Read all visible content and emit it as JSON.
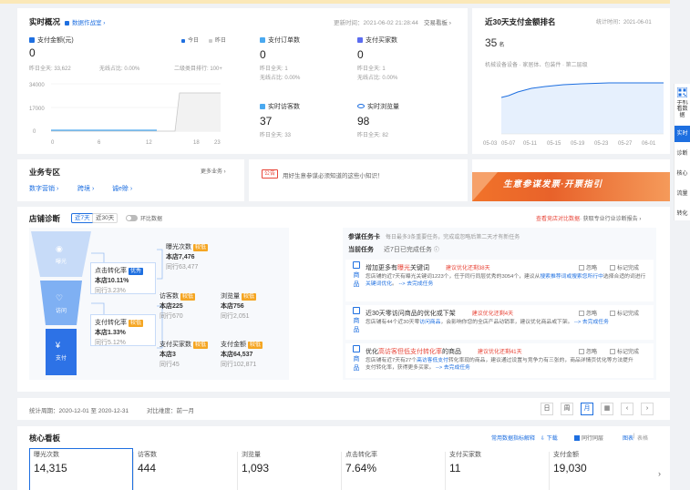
{
  "realtime": {
    "title": "实时概况",
    "indicator_link": "数据作战室 ›",
    "update_time": "更新时间：2021-06-02 21:28:44",
    "trade_link": "交易看板 ›",
    "pay_amount_label": "支付金额(元)",
    "legend_today": "今日",
    "legend_yesterday": "昨日",
    "pay_amount_value": "0",
    "yesterday_all": "昨日全天: 33,622",
    "wireless_ratio": "无线占比: 0.00%",
    "rank_text": "二级类目排行: 100+",
    "y_ticks": [
      "34000",
      "17000",
      "0"
    ],
    "x_ticks": [
      "0",
      "6",
      "12",
      "18",
      "23"
    ],
    "metrics": [
      {
        "icon": "orders-icon",
        "label": "支付订单数",
        "value": "0",
        "sub1": "昨日全天: 1",
        "sub2": "无线占比: 0.00%"
      },
      {
        "icon": "buyers-icon",
        "label": "支付买家数",
        "value": "0",
        "sub1": "昨日全天: 1",
        "sub2": "无线占比: 0.00%"
      },
      {
        "icon": "visitors-icon",
        "label": "实时访客数",
        "value": "37",
        "sub1": "昨日全天: 33",
        "sub2": ""
      },
      {
        "icon": "views-icon",
        "label": "实时浏览量",
        "value": "98",
        "sub1": "昨日全天: 82",
        "sub2": ""
      }
    ]
  },
  "ranking": {
    "title": "近30天支付金额排名",
    "stat_time": "统计时间：2021-06-01",
    "rank_value": "35",
    "rank_unit": "名",
    "category": "机械设备设备 · 家居体、包装件 · 第二层级",
    "x_ticks": [
      "05-03",
      "05-07",
      "05-11",
      "05-15",
      "05-19",
      "05-23",
      "05-27",
      "06-01"
    ]
  },
  "business": {
    "title": "业务专区",
    "more": "更多业务 ›",
    "links": [
      "数字营销 ›",
      "跨境 ›",
      "诚e赊 ›"
    ]
  },
  "notice": {
    "tag": "公告",
    "text": "用好生意参谋必须知道的这些小知识！"
  },
  "banner": {
    "text": "生意参谋发票·开票指引"
  },
  "diagnosis": {
    "title": "店铺诊断",
    "tab_7": "近7天",
    "tab_30": "近30天",
    "ring_toggle": "环比数据",
    "right_link_red": "查看竞店对比数据",
    "right_link": "· 获取专业行业诊断报告 ›",
    "funnel": [
      {
        "label": "曝光"
      },
      {
        "label": "访问"
      },
      {
        "label": "支付"
      }
    ],
    "exposure": {
      "label": "曝光次数",
      "tag": "较低",
      "store": "本店7,476",
      "peer": "同行63,477"
    },
    "click_rate": {
      "label": "点击转化率",
      "tag": "优秀",
      "store": "本店10.11%",
      "peer": "同行3.23%"
    },
    "visitors": {
      "label": "访客数",
      "tag": "较低",
      "store": "本店225",
      "peer": "同行670"
    },
    "pageviews": {
      "label": "浏览量",
      "tag": "较低",
      "store": "本店756",
      "peer": "同行2,051"
    },
    "pay_rate": {
      "label": "支付转化率",
      "tag": "较低",
      "store": "本店1.33%",
      "peer": "同行5.12%"
    },
    "buyers": {
      "label": "支付买家数",
      "tag": "较低",
      "store": "本店3",
      "peer": "同行45"
    },
    "amount": {
      "label": "支付金额",
      "tag": "较低",
      "store": "本店64,537",
      "peer": "同行102,871"
    }
  },
  "tasks": {
    "title": "参谋任务卡",
    "subtitle": "每日最多3条重要任务，完成或忽略后第二天才有新任务",
    "current_label": "当前任务",
    "done_label": "近7日已完成任务",
    "item_icon_label": "商品",
    "ignore": "忽略",
    "mark_done": "标记完成",
    "items": [
      {
        "title": "增加更多有",
        "title_red": "曝光",
        "title_tail": "关键词",
        "deadline": "建议优化还剩38天",
        "desc": "您店铺的近7天有曝光关键词1223个，任于同行同层优秀的3054个，建议从",
        "desc_blue": "搜索推荐词或搜索您所行中",
        "desc_tail": "选择合适的词进行",
        "desc2_blue": "关键词优化",
        "desc2_tail": "。",
        "action": "--> 去完成任务"
      },
      {
        "title": "近30天零访问商品的优化或下架",
        "title_red": "",
        "title_tail": "",
        "deadline": "建议优化还剩4天",
        "desc": "您店铺有44个近30天零",
        "desc_blue": "访问商品",
        "desc_tail": "，会影响你您的全店产品动销率，建议优化商品或下架。",
        "desc2_blue": "",
        "desc2_tail": "",
        "action": "--> 去完成任务"
      },
      {
        "title": "优化",
        "title_red": "高访客但低支付转化率",
        "title_tail": "的商品",
        "deadline": "建议优化还剩41天",
        "desc": "您店铺有近7天有27个",
        "desc_blue": "高访客低支付",
        "desc_tail": "转化率现的商品，建议通过设置与竞争力有三张的，商品详情页优化等方法提升",
        "desc2_blue": "",
        "desc2_tail": "支付转化率，获得更多买家。",
        "action": "--> 去完成任务"
      }
    ]
  },
  "stat_period": {
    "period": "统计周期：2020-12-01 至 2020-12-31",
    "compare": "对比维度：前一月",
    "buttons": [
      "日",
      "周",
      "月",
      "▦",
      "‹",
      "›"
    ]
  },
  "core": {
    "title": "核心看板",
    "explain_link": "常用数据指标解释",
    "download": "下载",
    "peer_avg": "同行同层",
    "chart_view": "图表",
    "table_view": "表格",
    "metrics": [
      {
        "label": "曝光次数",
        "value": "14,315"
      },
      {
        "label": "访客数",
        "value": "444"
      },
      {
        "label": "浏览量",
        "value": "1,093"
      },
      {
        "label": "点击转化率",
        "value": "7.64%"
      },
      {
        "label": "支付买家数",
        "value": "11"
      },
      {
        "label": "支付金额",
        "value": "19,030"
      }
    ]
  },
  "sidebar": {
    "qr_label": "手机看数据",
    "items": [
      "实时",
      "诊断",
      "核心",
      "流量",
      "转化"
    ]
  }
}
